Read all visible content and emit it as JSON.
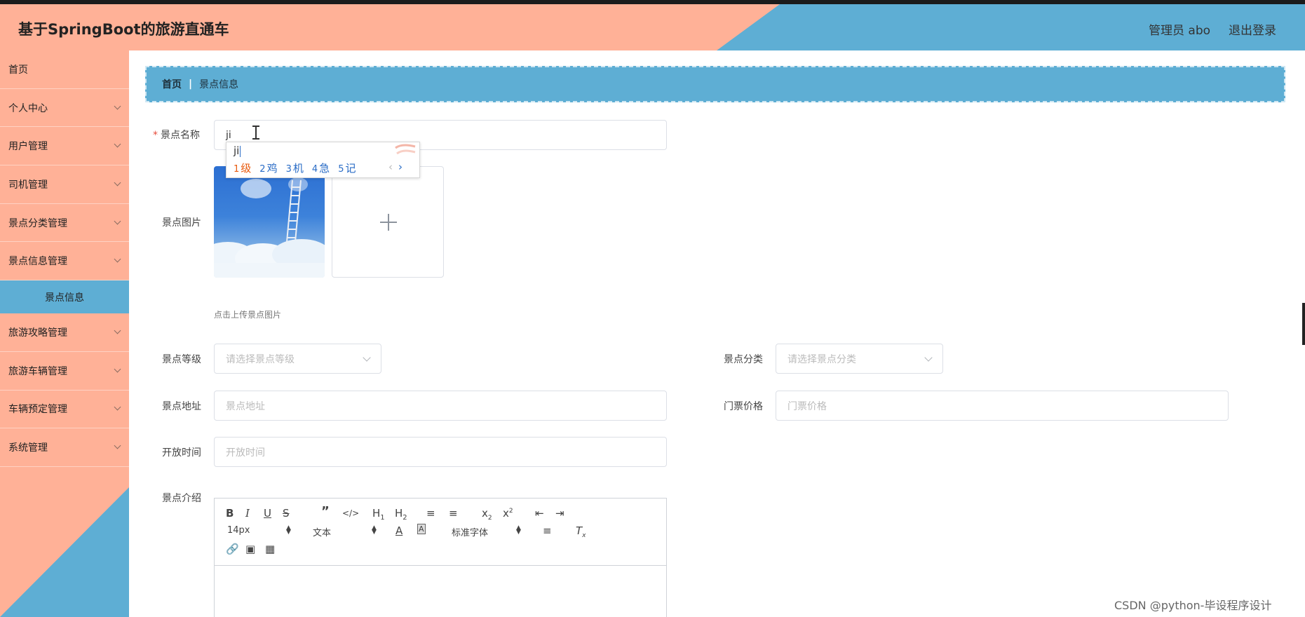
{
  "header": {
    "title": "基于SpringBoot的旅游直通车",
    "user": "管理员 abo",
    "logout": "退出登录"
  },
  "sidebar": {
    "items": [
      {
        "label": "首页",
        "has_arrow": false
      },
      {
        "label": "个人中心",
        "has_arrow": true
      },
      {
        "label": "用户管理",
        "has_arrow": true
      },
      {
        "label": "司机管理",
        "has_arrow": true
      },
      {
        "label": "景点分类管理",
        "has_arrow": true
      },
      {
        "label": "景点信息管理",
        "has_arrow": true
      },
      {
        "label": "旅游攻略管理",
        "has_arrow": true
      },
      {
        "label": "旅游车辆管理",
        "has_arrow": true
      },
      {
        "label": "车辆预定管理",
        "has_arrow": true
      },
      {
        "label": "系统管理",
        "has_arrow": true
      }
    ],
    "active_sub": "景点信息"
  },
  "breadcrumb": {
    "home": "首页",
    "separator": "|",
    "current": "景点信息"
  },
  "form": {
    "name": {
      "label": "景点名称",
      "required_mark": "*",
      "value": "ji"
    },
    "image": {
      "label": "景点图片",
      "tip": "点击上传景点图片"
    },
    "level": {
      "label": "景点等级",
      "placeholder": "请选择景点等级"
    },
    "category": {
      "label": "景点分类",
      "placeholder": "请选择景点分类"
    },
    "address": {
      "label": "景点地址",
      "placeholder": "景点地址"
    },
    "price": {
      "label": "门票价格",
      "placeholder": "门票价格"
    },
    "hours": {
      "label": "开放时间",
      "placeholder": "开放时间"
    },
    "intro": {
      "label": "景点介绍"
    }
  },
  "ime": {
    "composition": "ji",
    "candidates": [
      {
        "num": "1",
        "text": "级"
      },
      {
        "num": "2",
        "text": "鸡"
      },
      {
        "num": "3",
        "text": "机"
      },
      {
        "num": "4",
        "text": "急"
      },
      {
        "num": "5",
        "text": "记"
      }
    ],
    "prev": "‹",
    "next": "›"
  },
  "editor": {
    "font_size": "14px",
    "paragraph": "文本",
    "font_family": "标准字体"
  },
  "watermark": "CSDN @python-毕设程序设计",
  "colors": {
    "salmon": "#ffb197",
    "blue": "#5eaed4"
  }
}
